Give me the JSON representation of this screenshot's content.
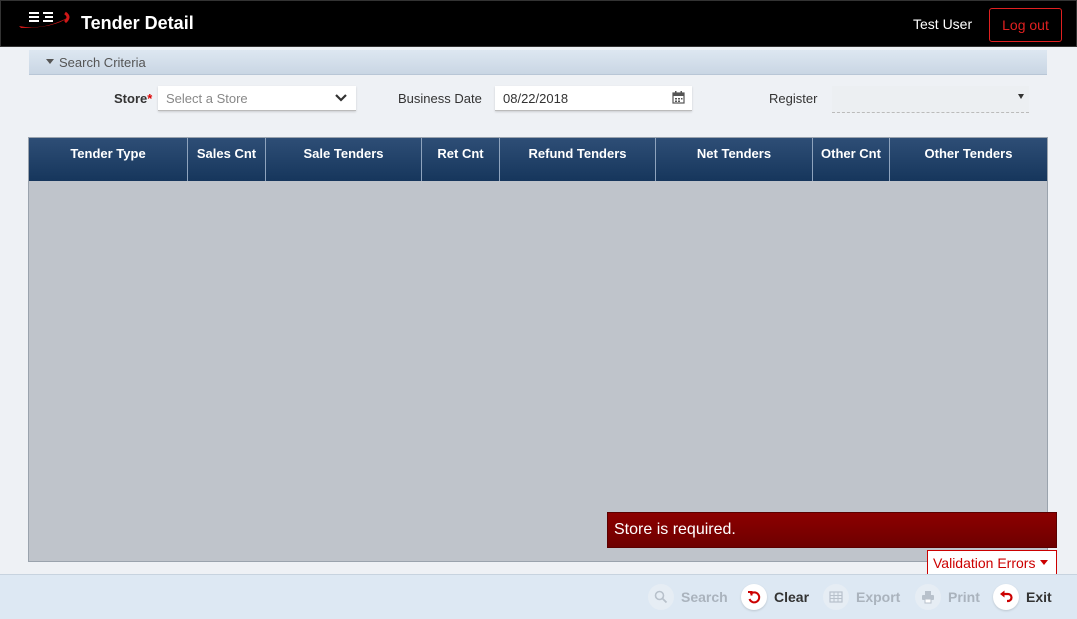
{
  "header": {
    "title": "Tender Detail",
    "user_name": "Test User",
    "logout_label": "Log out",
    "logo_text": "E3"
  },
  "search_criteria": {
    "section_label": "Search Criteria",
    "store_label": "Store",
    "store_required_mark": "*",
    "store_placeholder": "Select a Store",
    "business_date_label": "Business Date",
    "business_date_value": "08/22/2018",
    "register_label": "Register",
    "register_value": ""
  },
  "grid": {
    "columns": [
      "Tender Type",
      "Sales Cnt",
      "Sale Tenders",
      "Ret Cnt",
      "Refund Tenders",
      "Net Tenders",
      "Other Cnt",
      "Other Tenders"
    ],
    "rows": []
  },
  "validation": {
    "error_message": "Store is required.",
    "toggle_label": "Validation Errors"
  },
  "footer": {
    "search_label": "Search",
    "clear_label": "Clear",
    "export_label": "Export",
    "print_label": "Print",
    "exit_label": "Exit"
  },
  "colors": {
    "header_bg": "#000000",
    "accent_red": "#cc0000",
    "grid_header": "#1f3f66",
    "error_banner": "#7a0000"
  }
}
